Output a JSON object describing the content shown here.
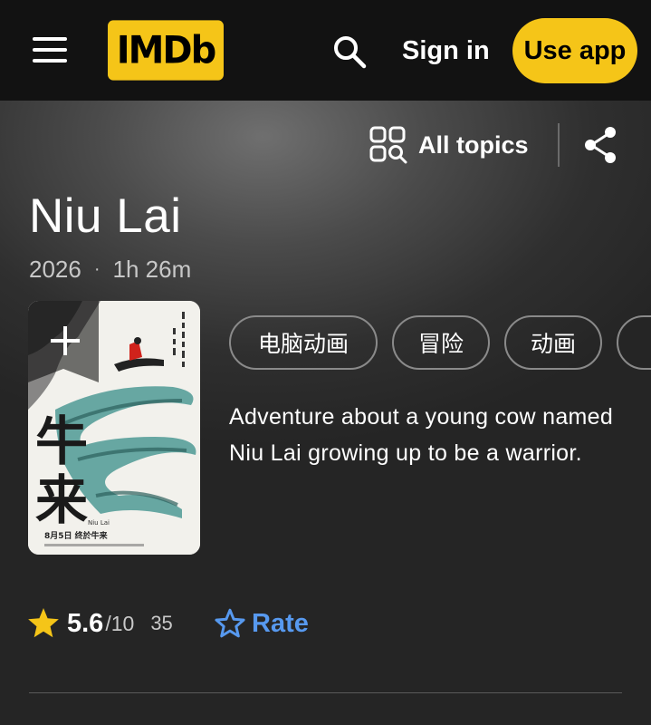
{
  "header": {
    "logo_text": "IMDb",
    "sign_in_label": "Sign in",
    "use_app_label": "Use app",
    "accent_color": "#f5c518"
  },
  "toolbar": {
    "all_topics_label": "All topics",
    "icons": [
      "all-topics-icon",
      "share-icon"
    ]
  },
  "title": {
    "name": "Niu Lai",
    "year": "2026",
    "separator": "·",
    "runtime": "1h 26m"
  },
  "poster": {
    "title_chars": "牛来",
    "subtitle": "Niu Lai",
    "release_line": "8月5日  终於牛来",
    "add_icon": "plus-icon"
  },
  "genres": [
    "电脑动画",
    "冒险",
    "动画"
  ],
  "plot": "Adventure about a young cow named Niu Lai growing up to be a warrior.",
  "rating": {
    "value": "5.6",
    "max": "/10",
    "count": "35",
    "rate_label": "Rate",
    "star_color": "#f5c518",
    "rate_color": "#5799ef"
  }
}
